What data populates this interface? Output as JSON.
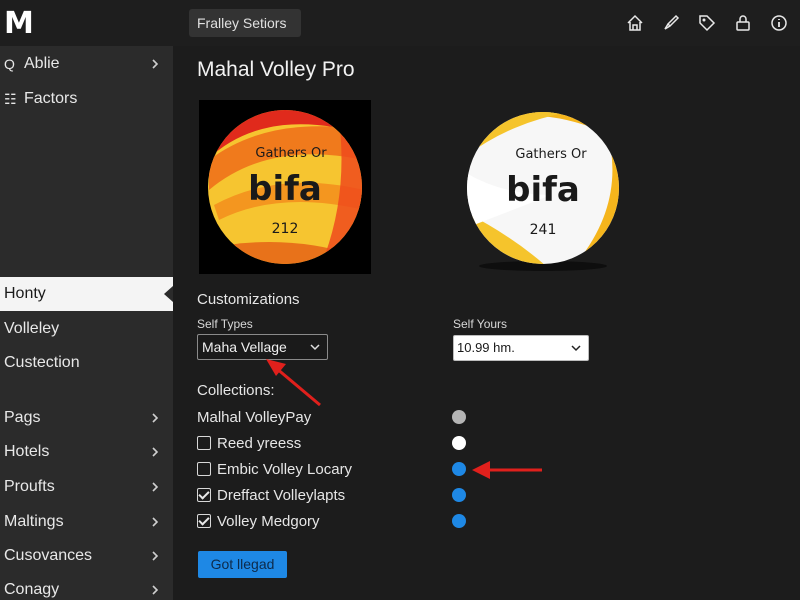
{
  "app": {
    "logo": "M"
  },
  "topbar": {
    "tab_label": "Fralley Setiors",
    "icons": [
      "home-icon",
      "brush-icon",
      "tag-icon",
      "lock-icon",
      "info-icon"
    ]
  },
  "sidebar": {
    "items": [
      {
        "label": "Ablie",
        "icon": "search-icon",
        "icon_glyph": "Q",
        "has_chevron": true
      },
      {
        "label": "Factors",
        "icon": "grid-icon",
        "icon_glyph": "☷",
        "has_chevron": false
      },
      {
        "label": "Honty",
        "icon": "",
        "has_chevron": false,
        "active": true
      },
      {
        "label": "Volleley",
        "has_chevron": false
      },
      {
        "label": "Custection",
        "has_chevron": false
      },
      {
        "label": "Pags",
        "has_chevron": true
      },
      {
        "label": "Hotels",
        "has_chevron": true
      },
      {
        "label": "Proufts",
        "has_chevron": true
      },
      {
        "label": "Maltings",
        "has_chevron": true
      },
      {
        "label": "Cusovances",
        "has_chevron": true
      },
      {
        "label": "Conagy",
        "has_chevron": true
      }
    ]
  },
  "main": {
    "title": "Mahal Volley Pro",
    "balls": [
      {
        "line1": "Gathers Or",
        "line2": "bifa",
        "line3": "212"
      },
      {
        "line1": "Gathers Or",
        "line2": "bifa",
        "line3": "241"
      }
    ],
    "customizations_label": "Customizations",
    "self_types_label": "Self Types",
    "self_types_value": "Maha Vellage",
    "self_yours_label": "Self Yours",
    "self_yours_value": "10.99 hm.",
    "collections_label": "Collections:",
    "collections": [
      {
        "label": "Malhal VolleyPay",
        "checkbox": null,
        "dot_color": "#b5b5b5"
      },
      {
        "label": "Reed yreess",
        "checkbox": false,
        "dot_color": "#ffffff"
      },
      {
        "label": "Embic Volley Locary",
        "checkbox": false,
        "dot_color": "#1e88e5"
      },
      {
        "label": "Dreffact Volleylapts",
        "checkbox": true,
        "dot_color": "#1e88e5"
      },
      {
        "label": "Volley Medgory",
        "checkbox": true,
        "dot_color": "#1e88e5"
      }
    ],
    "button_label": "Got llegad"
  },
  "colors": {
    "accent": "#1e88e5",
    "annotation_arrow": "#e0201c",
    "sidebar_bg": "#2b2b2b",
    "main_bg": "#1c1c1c"
  }
}
